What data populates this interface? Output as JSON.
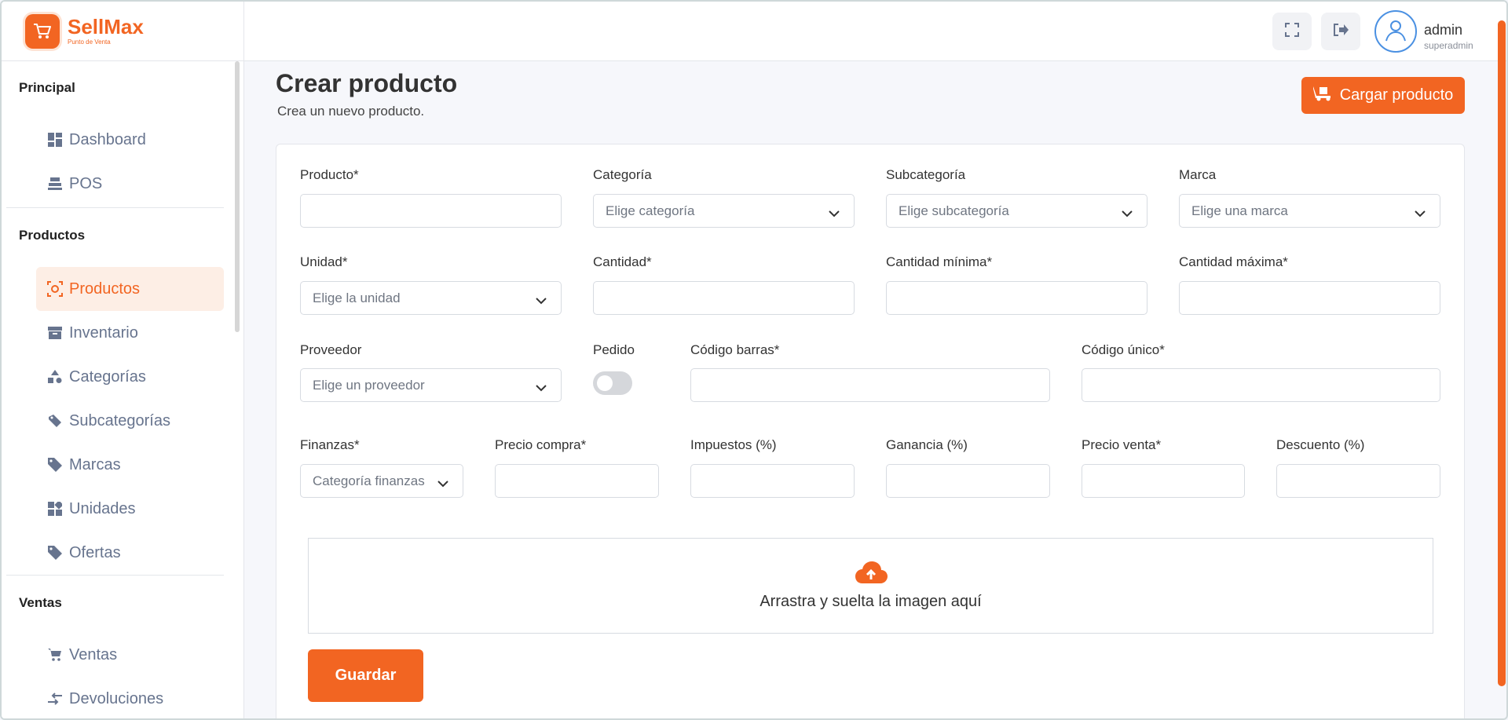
{
  "brand": {
    "name": "SellMax",
    "subtitle": "Punto de Venta"
  },
  "header": {
    "user_name": "admin",
    "user_role": "superadmin"
  },
  "sidebar": {
    "sections": [
      {
        "title": "Principal"
      },
      {
        "title": "Productos"
      },
      {
        "title": "Ventas"
      }
    ],
    "items": [
      {
        "label": "Dashboard",
        "icon": "dashboard-icon"
      },
      {
        "label": "POS",
        "icon": "pos-icon"
      },
      {
        "label": "Productos",
        "icon": "products-icon",
        "active": true
      },
      {
        "label": "Inventario",
        "icon": "archive-icon"
      },
      {
        "label": "Categorías",
        "icon": "shapes-icon"
      },
      {
        "label": "Subcategorías",
        "icon": "tags-icon"
      },
      {
        "label": "Marcas",
        "icon": "tag-icon"
      },
      {
        "label": "Unidades",
        "icon": "grid-icon"
      },
      {
        "label": "Ofertas",
        "icon": "tag-icon"
      },
      {
        "label": "Ventas",
        "icon": "cart-icon"
      },
      {
        "label": "Devoluciones",
        "icon": "arrows-icon"
      }
    ]
  },
  "page": {
    "title": "Crear producto",
    "subtitle": "Crea un nuevo producto.",
    "load_button": "Cargar producto"
  },
  "form": {
    "producto_label": "Producto*",
    "categoria_label": "Categoría",
    "categoria_placeholder": "Elige categoría",
    "subcategoria_label": "Subcategoría",
    "subcategoria_placeholder": "Elige subcategoría",
    "marca_label": "Marca",
    "marca_placeholder": "Elige una marca",
    "unidad_label": "Unidad*",
    "unidad_placeholder": "Elige la unidad",
    "cantidad_label": "Cantidad*",
    "cantidad_min_label": "Cantidad mínima*",
    "cantidad_max_label": "Cantidad máxima*",
    "proveedor_label": "Proveedor",
    "proveedor_placeholder": "Elige un proveedor",
    "pedido_label": "Pedido",
    "codigo_barras_label": "Código barras*",
    "codigo_unico_label": "Código único*",
    "finanzas_label": "Finanzas*",
    "finanzas_placeholder": "Categoría finanzas",
    "precio_compra_label": "Precio compra*",
    "impuestos_label": "Impuestos (%)",
    "ganancia_label": "Ganancia (%)",
    "precio_venta_label": "Precio venta*",
    "descuento_label": "Descuento (%)",
    "dropzone_text": "Arrastra y suelta la imagen aquí",
    "save_button": "Guardar"
  },
  "colors": {
    "accent": "#f26522",
    "active_bg": "#fdeee5"
  }
}
